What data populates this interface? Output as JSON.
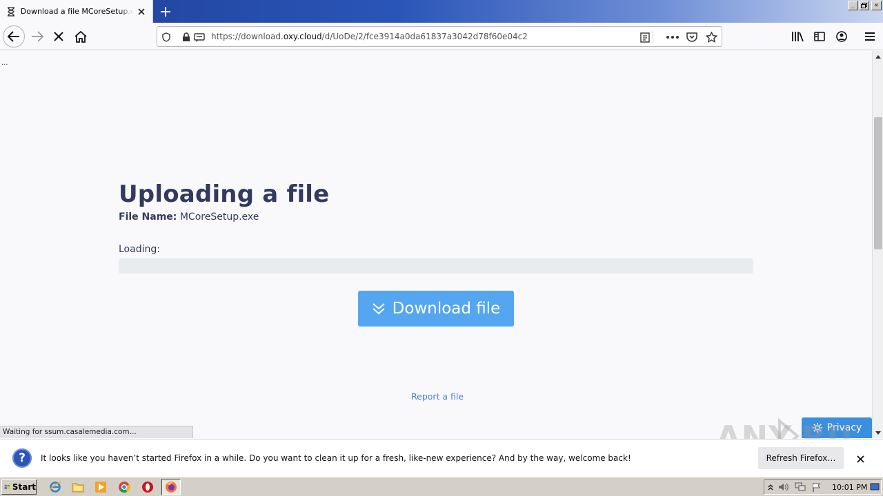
{
  "browser": {
    "tab_title": "Download a file MCoreSetup.exe on OXY.CLOUD",
    "url_prefix": "https://download.",
    "url_domain": "oxy.cloud",
    "url_path": "/d/UoDe/2/fce3914a0da61837a3042d78f60e04c2",
    "status_text": "Waiting for ssum.casalemedia.com...",
    "window_min": "_",
    "window_restore": "▫",
    "window_close": "✕"
  },
  "page": {
    "ellipsis": "...",
    "heading": "Uploading a file",
    "file_name_label": "File Name:",
    "file_name_value": "MCoreSetup.exe",
    "loading_label": "Loading:",
    "progress_fraction": 0,
    "download_button": "Download file",
    "report_link": "Report a file",
    "privacy_button": "Privacy",
    "accent_color": "#54a6f0"
  },
  "notification": {
    "message": "It looks like you haven’t started Firefox in a while. Do you want to clean it up for a fresh, like-new experience? And by the way, welcome back!",
    "action_button": "Refresh Firefox…"
  },
  "watermark": "ANY.RUN",
  "taskbar": {
    "start_label": "Start",
    "clock": "10:01 PM",
    "icons": [
      "ie-icon",
      "explorer-icon",
      "media-player-icon",
      "chrome-icon",
      "opera-icon",
      "firefox-icon"
    ]
  }
}
